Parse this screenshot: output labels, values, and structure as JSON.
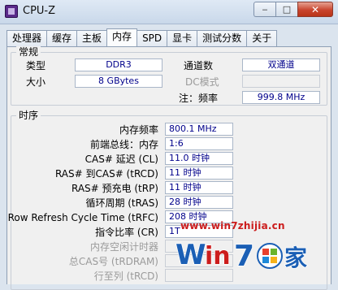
{
  "window": {
    "title": "CPU-Z",
    "minimize_glyph": "‒",
    "maximize_glyph": "□",
    "close_glyph": "✕"
  },
  "tabs": [
    "处理器",
    "缓存",
    "主板",
    "内存",
    "SPD",
    "显卡",
    "测试分数",
    "关于"
  ],
  "active_tab": "内存",
  "general": {
    "title": "常规",
    "type_label": "类型",
    "type_value": "DDR3",
    "size_label": "大小",
    "size_value": "8 GBytes",
    "channels_label": "通道数",
    "channels_value": "双通道",
    "dc_mode_label": "DC模式",
    "dc_mode_value": "",
    "note_label": "注：频率",
    "note_value": "999.8 MHz"
  },
  "timings": {
    "title": "时序",
    "rows": [
      {
        "label": "内存频率",
        "value": "800.1 MHz",
        "disabled": false
      },
      {
        "label": "前端总线：内存",
        "value": "1:6",
        "disabled": false
      },
      {
        "label": "CAS# 延迟 (CL)",
        "value": "11.0 时钟",
        "disabled": false
      },
      {
        "label": "RAS# 到CAS# (tRCD)",
        "value": "11 时钟",
        "disabled": false
      },
      {
        "label": "RAS# 预充电 (tRP)",
        "value": "11 时钟",
        "disabled": false
      },
      {
        "label": "循环周期 (tRAS)",
        "value": "28 时钟",
        "disabled": false
      },
      {
        "label": "Row Refresh Cycle Time (tRFC)",
        "value": "208 时钟",
        "disabled": false
      },
      {
        "label": "指令比率 (CR)",
        "value": "1T",
        "disabled": false
      },
      {
        "label": "内存空闲计时器",
        "value": "",
        "disabled": true
      },
      {
        "label": "总CAS号 (tRDRAM)",
        "value": "",
        "disabled": true
      },
      {
        "label": "行至列 (tRCD)",
        "value": "",
        "disabled": true
      }
    ]
  },
  "watermark": {
    "url": "www.win7zhijia.cn",
    "brand": "Win7",
    "suffix": "之家"
  },
  "colors": {
    "value_text": "#00008b",
    "watermark_red": "#cc1d1d",
    "watermark_blue": "#1b5fb5"
  }
}
